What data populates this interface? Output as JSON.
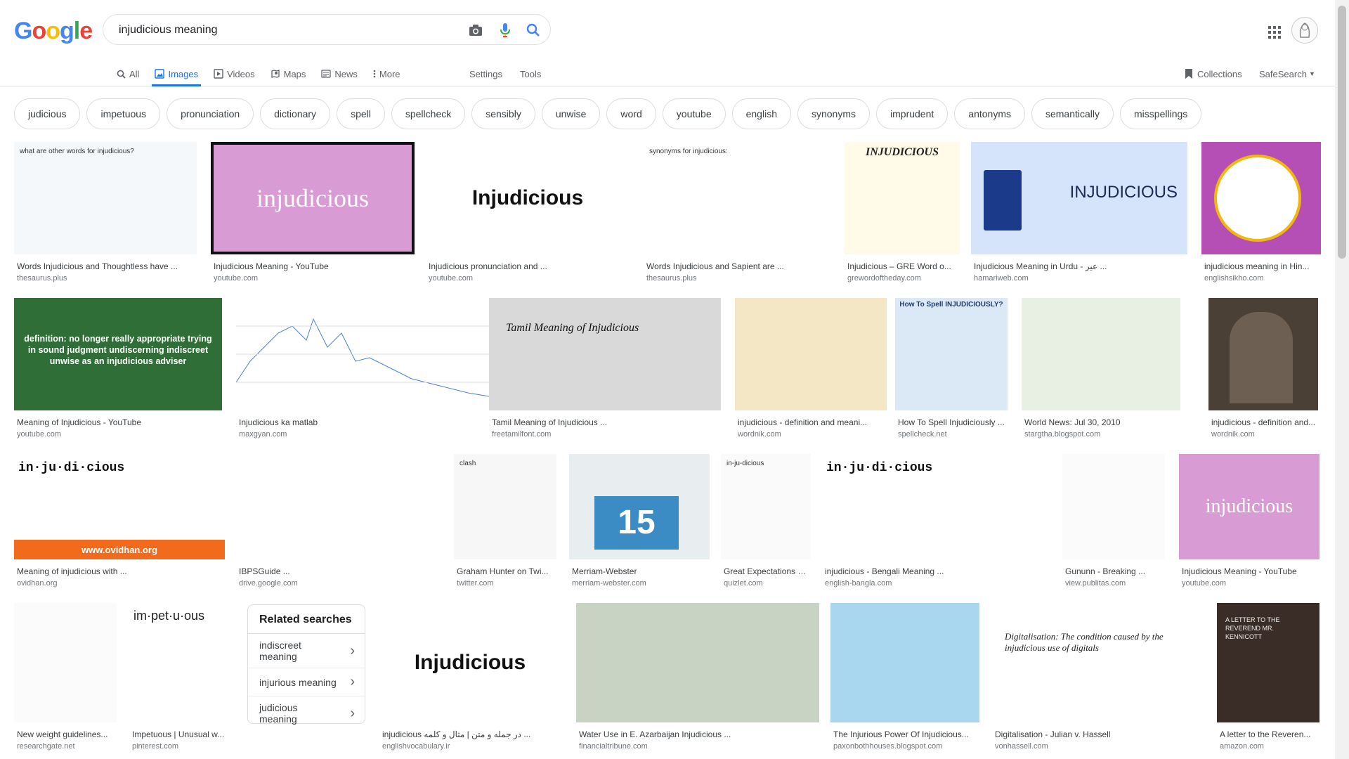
{
  "search": {
    "query": "injudicious meaning"
  },
  "logo": {
    "letters": [
      "G",
      "o",
      "o",
      "g",
      "l",
      "e"
    ],
    "colors": [
      "#4285F4",
      "#EA4335",
      "#FBBC05",
      "#4285F4",
      "#34A853",
      "#EA4335"
    ]
  },
  "tabs": [
    {
      "label": "All",
      "icon": "search-icon"
    },
    {
      "label": "Images",
      "icon": "image-icon",
      "active": true
    },
    {
      "label": "Videos",
      "icon": "video-icon"
    },
    {
      "label": "Maps",
      "icon": "map-icon"
    },
    {
      "label": "News",
      "icon": "news-icon"
    },
    {
      "label": "More",
      "icon": "more-vert-icon"
    }
  ],
  "tools": {
    "settings": "Settings",
    "tools": "Tools"
  },
  "rhs": {
    "collections": "Collections",
    "safesearch": "SafeSearch"
  },
  "chips": [
    "judicious",
    "impetuous",
    "pronunciation",
    "dictionary",
    "spell",
    "spellcheck",
    "sensibly",
    "unwise",
    "word",
    "youtube",
    "english",
    "synonyms",
    "imprudent",
    "antonyms",
    "semantically",
    "misspellings"
  ],
  "row1": [
    {
      "title": "Words Injudicious and Thoughtless have ...",
      "source": "thesaurus.plus",
      "thumb_text": "what are other words for injudicious?",
      "bg": "#f4f8fb"
    },
    {
      "title": "Injudicious Meaning - YouTube",
      "source": "youtube.com",
      "thumb_text": "injudicious",
      "bg": "#d99bd4"
    },
    {
      "title": "Injudicious pronunciation and ...",
      "source": "youtube.com",
      "thumb_text": "Injudicious",
      "bg": "#ffffff"
    },
    {
      "title": "Words Injudicious and Sapient are ...",
      "source": "thesaurus.plus",
      "thumb_text": "synonyms for injudicious:",
      "bg": "#ffffff"
    },
    {
      "title": "Injudicious – GRE Word o...",
      "source": "grewordoftheday.com",
      "thumb_text": "INJUDICIOUS",
      "bg": "#fffbe8"
    },
    {
      "title": "Injudicious Meaning in Urdu - عیر ...",
      "source": "hamariweb.com",
      "thumb_text": "INJUDICIOUS",
      "bg": "#d6e4fb"
    },
    {
      "title": "injudicious meaning in Hin...",
      "source": "englishsikho.com",
      "thumb_text": "",
      "bg": "#b54fb5"
    }
  ],
  "row2": [
    {
      "title": "Meaning of Injudicious - YouTube",
      "source": "youtube.com",
      "thumb_text": "definition: no longer really appropriate trying in sound judgment undiscerning indiscreet unwise as an injudicious adviser",
      "bg": "#2f6e36"
    },
    {
      "title": "Injudicious ka matlab",
      "source": "maxgyan.com",
      "thumb_text": "",
      "bg": "#ffffff"
    },
    {
      "title": "Tamil Meaning of Injudicious ...",
      "source": "freetamilfont.com",
      "thumb_text": "Tamil Meaning of Injudicious",
      "bg": "#d9d9d9"
    },
    {
      "title": "injudicious - definition and meani...",
      "source": "wordnik.com",
      "thumb_text": "",
      "bg": "#f3e7c6"
    },
    {
      "title": "How To Spell Injudiciously ...",
      "source": "spellcheck.net",
      "thumb_text": "How To Spell INJUDICIOUSLY?",
      "bg": "#dbe8f6"
    },
    {
      "title": "World News: Jul 30, 2010",
      "source": "stargtha.blogspot.com",
      "thumb_text": "",
      "bg": "#e8f0e3"
    },
    {
      "title": "injudicious - definition and...",
      "source": "wordnik.com",
      "thumb_text": "",
      "bg": "#4a4036"
    }
  ],
  "row3": [
    {
      "title": "Meaning of injudicious with ...",
      "source": "ovidhan.org",
      "thumb_text": "in·ju·di·cious",
      "bg": "#ffffff"
    },
    {
      "title": "IBPSGuide ...",
      "source": "drive.google.com",
      "thumb_text": "",
      "bg": "#ffffff"
    },
    {
      "title": "Graham Hunter on Twi...",
      "source": "twitter.com",
      "thumb_text": "clash",
      "bg": "#f7f7f7"
    },
    {
      "title": "Merriam-Webster",
      "source": "merriam-webster.com",
      "thumb_text": "15",
      "bg": "#e8edf0"
    },
    {
      "title": "Great Expectations C...",
      "source": "quizlet.com",
      "thumb_text": "in-ju-dicious",
      "bg": "#fafafa"
    },
    {
      "title": "injudicious - Bengali Meaning ...",
      "source": "english-bangla.com",
      "thumb_text": "in·ju·di·cious",
      "bg": "#ffffff"
    },
    {
      "title": "Gununn - Breaking ...",
      "source": "view.publitas.com",
      "thumb_text": "",
      "bg": "#fbfbfb"
    },
    {
      "title": "Injudicious Meaning - YouTube",
      "source": "youtube.com",
      "thumb_text": "injudicious",
      "bg": "#d99bd4"
    }
  ],
  "row4": [
    {
      "title": "New weight guidelines...",
      "source": "researchgate.net",
      "thumb_text": "",
      "bg": "#fbfbfb"
    },
    {
      "title": "Impetuous | Unusual w...",
      "source": "pinterest.com",
      "thumb_text": "im·pet·u·ous",
      "bg": "#ffffff"
    },
    {
      "title": "injudicious در جمله و متن | مثال و کلمه ...",
      "source": "englishvocabulary.ir",
      "thumb_text": "Injudicious",
      "bg": "#ffffff"
    },
    {
      "title": "Water Use in E. Azarbaijan Injudicious ...",
      "source": "financialtribune.com",
      "thumb_text": "",
      "bg": "#c8d3c3"
    },
    {
      "title": "The Injurious Power Of Injudicious...",
      "source": "paxonbothhouses.blogspot.com",
      "thumb_text": "",
      "bg": "#a9d7ef"
    },
    {
      "title": "Digitalisation - Julian v. Hassell",
      "source": "vonhassell.com",
      "thumb_text": "Digitalisation: The condition caused by the injudicious use of digitals",
      "bg": "#ffffff"
    },
    {
      "title": "A letter to the Reveren...",
      "source": "amazon.com",
      "thumb_text": "A LETTER TO THE REVEREND MR. KENNICOTT",
      "bg": "#3a2d28"
    }
  ],
  "related": {
    "title": "Related searches",
    "items": [
      "indiscreet meaning",
      "injurious meaning",
      "judicious meaning"
    ]
  }
}
